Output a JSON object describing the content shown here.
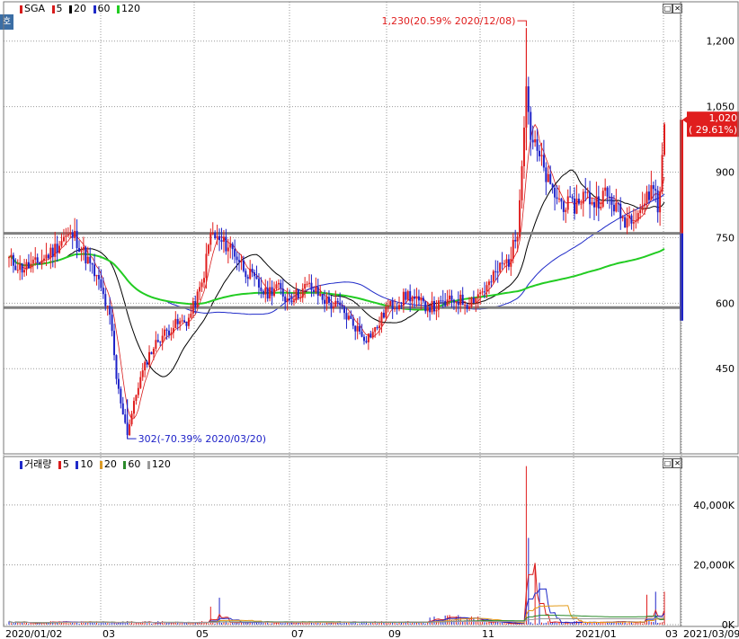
{
  "tab_label": "호",
  "price_legend": {
    "stock": "SGA",
    "ma": [
      {
        "label": "5",
        "color": "#d81c1c"
      },
      {
        "label": "20",
        "color": "#000000"
      },
      {
        "label": "60",
        "color": "#1f2ac8"
      },
      {
        "label": "120",
        "color": "#22cc22"
      }
    ]
  },
  "volume_legend": {
    "label": "거래량",
    "ma": [
      {
        "label": "5",
        "color": "#d81c1c"
      },
      {
        "label": "10",
        "color": "#1f2ac8"
      },
      {
        "label": "20",
        "color": "#e39b1a"
      },
      {
        "label": "60",
        "color": "#2a8a2a"
      },
      {
        "label": "120",
        "color": "#999999"
      }
    ]
  },
  "colors": {
    "up": "#e01e1e",
    "down": "#1e22c8",
    "hline": "#808080",
    "current": "#e01e1e"
  },
  "chart_data": [
    {
      "type": "candlestick",
      "title": "SGA",
      "y_ticks": [
        "1,200",
        "1,050",
        "900",
        "750",
        "600",
        "450"
      ],
      "y_tick_values": [
        1200,
        1050,
        900,
        750,
        600,
        450
      ],
      "ylim": [
        255,
        1290
      ],
      "x_ticks": [
        "2020/01/02",
        "03",
        "05",
        "07",
        "09",
        "11",
        "2021/01",
        "03",
        "2021/03/09"
      ],
      "current_price": "1,020",
      "current_change": "( 29.61%)",
      "current_value": 1020,
      "high_annotation": "1,230(20.59% 2020/12/08)",
      "high_value": 1230,
      "low_annotation": "302(-70.39% 2020/03/20)",
      "low_value": 302,
      "support_lines": [
        760,
        590
      ],
      "close_path": [
        [
          "2020/01/02",
          700
        ],
        [
          "2020/01/10",
          680
        ],
        [
          "2020/01/20",
          690
        ],
        [
          "2020/01/31",
          720
        ],
        [
          "2020/02/07",
          750
        ],
        [
          "2020/02/14",
          755
        ],
        [
          "2020/02/24",
          690
        ],
        [
          "2020/03/02",
          640
        ],
        [
          "2020/03/09",
          560
        ],
        [
          "2020/03/13",
          420
        ],
        [
          "2020/03/20",
          302
        ],
        [
          "2020/03/27",
          410
        ],
        [
          "2020/04/03",
          480
        ],
        [
          "2020/04/10",
          520
        ],
        [
          "2020/04/20",
          550
        ],
        [
          "2020/04/29",
          560
        ],
        [
          "2020/05/08",
          640
        ],
        [
          "2020/05/14",
          760
        ],
        [
          "2020/05/20",
          740
        ],
        [
          "2020/05/27",
          730
        ],
        [
          "2020/06/05",
          680
        ],
        [
          "2020/06/12",
          650
        ],
        [
          "2020/06/19",
          620
        ],
        [
          "2020/06/26",
          640
        ],
        [
          "2020/07/03",
          610
        ],
        [
          "2020/07/10",
          620
        ],
        [
          "2020/07/17",
          640
        ],
        [
          "2020/07/24",
          620
        ],
        [
          "2020/07/31",
          600
        ],
        [
          "2020/08/07",
          590
        ],
        [
          "2020/08/14",
          560
        ],
        [
          "2020/08/24",
          520
        ],
        [
          "2020/08/31",
          540
        ],
        [
          "2020/09/07",
          590
        ],
        [
          "2020/09/14",
          600
        ],
        [
          "2020/09/21",
          620
        ],
        [
          "2020/09/28",
          600
        ],
        [
          "2020/10/08",
          590
        ],
        [
          "2020/10/16",
          600
        ],
        [
          "2020/10/23",
          610
        ],
        [
          "2020/10/30",
          600
        ],
        [
          "2020/11/06",
          620
        ],
        [
          "2020/11/13",
          640
        ],
        [
          "2020/11/20",
          680
        ],
        [
          "2020/11/27",
          700
        ],
        [
          "2020/12/02",
          760
        ],
        [
          "2020/12/08",
          1100
        ],
        [
          "2020/12/11",
          980
        ],
        [
          "2020/12/18",
          920
        ],
        [
          "2020/12/24",
          860
        ],
        [
          "2020/12/31",
          830
        ],
        [
          "2021/01/08",
          820
        ],
        [
          "2021/01/15",
          850
        ],
        [
          "2021/01/22",
          830
        ],
        [
          "2021/01/29",
          850
        ],
        [
          "2021/02/05",
          820
        ],
        [
          "2021/02/10",
          790
        ],
        [
          "2021/02/19",
          810
        ],
        [
          "2021/02/26",
          840
        ],
        [
          "2021/03/02",
          880
        ],
        [
          "2021/03/05",
          800
        ],
        [
          "2021/03/09",
          1020
        ]
      ]
    },
    {
      "type": "bar",
      "title": "거래량",
      "y_ticks": [
        "40,000K",
        "20,000K",
        "0K"
      ],
      "y_tick_values": [
        40000,
        20000,
        0
      ],
      "ylim": [
        0,
        55000
      ],
      "unit": "K",
      "spikes": [
        [
          "2020/05/14",
          6000
        ],
        [
          "2020/05/19",
          9000
        ],
        [
          "2020/12/08",
          53000
        ],
        [
          "2020/12/10",
          29000
        ],
        [
          "2020/12/14",
          20000
        ],
        [
          "2020/12/17",
          14000
        ],
        [
          "2021/02/26",
          10000
        ],
        [
          "2021/03/03",
          11000
        ],
        [
          "2021/03/09",
          11000
        ]
      ]
    }
  ]
}
